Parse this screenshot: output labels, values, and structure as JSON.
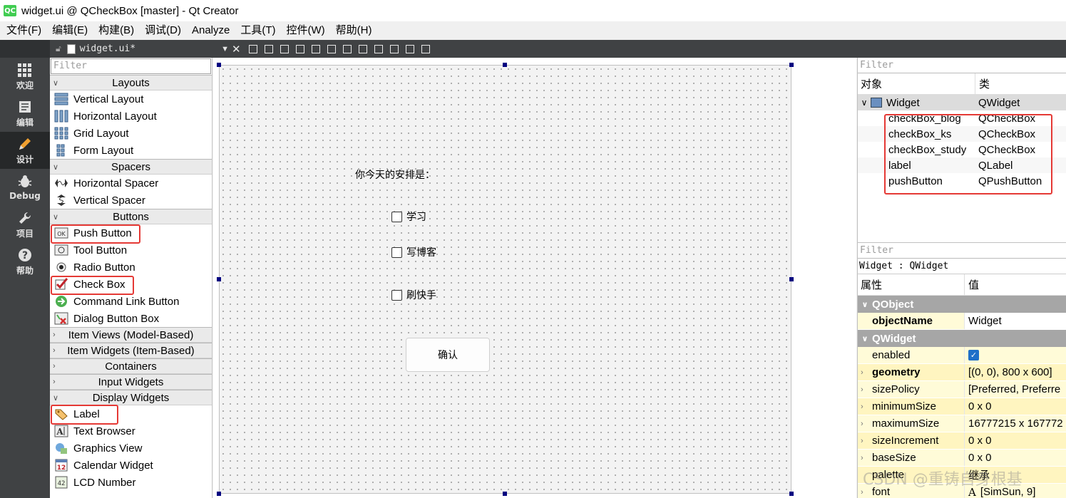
{
  "titlebar": {
    "logo": "QC",
    "title": "widget.ui @ QCheckBox [master] - Qt Creator"
  },
  "menu": [
    "文件(F)",
    "编辑(E)",
    "构建(B)",
    "调试(D)",
    "Analyze",
    "工具(T)",
    "控件(W)",
    "帮助(H)"
  ],
  "modes": [
    {
      "label": "欢迎",
      "icon": "grid-icon"
    },
    {
      "label": "编辑",
      "icon": "edit-doc-icon"
    },
    {
      "label": "设计",
      "icon": "pencil-icon"
    },
    {
      "label": "Debug",
      "icon": "bug-icon"
    },
    {
      "label": "项目",
      "icon": "wrench-icon"
    },
    {
      "label": "帮助",
      "icon": "help-icon"
    }
  ],
  "document": {
    "filename": "widget.ui*"
  },
  "widgetbox": {
    "filter_placeholder": "Filter",
    "categories": {
      "layouts": "Layouts",
      "spacers": "Spacers",
      "buttons": "Buttons",
      "item_views": "Item Views (Model-Based)",
      "item_widgets": "Item Widgets (Item-Based)",
      "containers": "Containers",
      "input_widgets": "Input Widgets",
      "display_widgets": "Display Widgets"
    },
    "layouts": [
      "Vertical Layout",
      "Horizontal Layout",
      "Grid Layout",
      "Form Layout"
    ],
    "spacers": [
      "Horizontal Spacer",
      "Vertical Spacer"
    ],
    "buttons": [
      "Push Button",
      "Tool Button",
      "Radio Button",
      "Check Box",
      "Command Link Button",
      "Dialog Button Box"
    ],
    "display": [
      "Label",
      "Text Browser",
      "Graphics View",
      "Calendar Widget",
      "LCD Number"
    ]
  },
  "form": {
    "label": "你今天的安排是：",
    "checkboxes": [
      "学习",
      "写博客",
      "刷快手"
    ],
    "button": "确认"
  },
  "object_inspector": {
    "filter_placeholder": "Filter",
    "col_object": "对象",
    "col_class": "类",
    "root": {
      "name": "Widget",
      "class": "QWidget"
    },
    "children": [
      {
        "name": "checkBox_blog",
        "class": "QCheckBox"
      },
      {
        "name": "checkBox_ks",
        "class": "QCheckBox"
      },
      {
        "name": "checkBox_study",
        "class": "QCheckBox"
      },
      {
        "name": "label",
        "class": "QLabel"
      },
      {
        "name": "pushButton",
        "class": "QPushButton"
      }
    ]
  },
  "property_editor": {
    "filter_placeholder": "Filter",
    "title": "Widget : QWidget",
    "col_property": "属性",
    "col_value": "值",
    "group_qobject": "QObject",
    "objectName": {
      "name": "objectName",
      "value": "Widget"
    },
    "group_qwidget": "QWidget",
    "props": [
      {
        "name": "enabled",
        "value": ""
      },
      {
        "name": "geometry",
        "value": "[(0, 0), 800 x 600]"
      },
      {
        "name": "sizePolicy",
        "value": "[Preferred, Preferre"
      },
      {
        "name": "minimumSize",
        "value": "0 x 0"
      },
      {
        "name": "maximumSize",
        "value": "16777215 x 167772"
      },
      {
        "name": "sizeIncrement",
        "value": "0 x 0"
      },
      {
        "name": "baseSize",
        "value": "0 x 0"
      },
      {
        "name": "palette",
        "value": "继承"
      },
      {
        "name": "font",
        "value": "[SimSun, 9]"
      }
    ]
  },
  "watermark": "CSDN @重铸自身根基",
  "colors": {
    "highlight": "#e53935",
    "mode_bar": "#404244",
    "selection_handle": "#000080",
    "checkbox_checked": "#1f6fc8"
  }
}
